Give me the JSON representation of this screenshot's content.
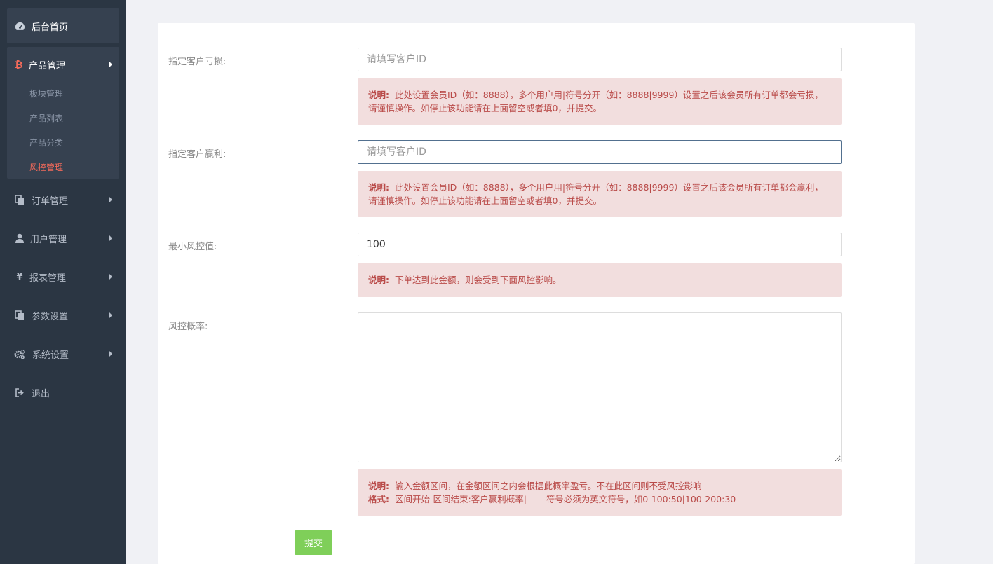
{
  "sidebar": {
    "home": {
      "label": "后台首页",
      "icon": "dashboard-icon"
    },
    "product": {
      "label": "产品管理",
      "icon": "bitcoin-icon",
      "icon_color": "#f36a5a",
      "items": [
        {
          "label": "板块管理"
        },
        {
          "label": "产品列表"
        },
        {
          "label": "产品分类"
        },
        {
          "label": "风控管理",
          "active": true
        }
      ]
    },
    "items": [
      {
        "label": "订单管理",
        "icon": "copy-icon"
      },
      {
        "label": "用户管理",
        "icon": "user-icon"
      },
      {
        "label": "报表管理",
        "icon": "yen-icon"
      },
      {
        "label": "参数设置",
        "icon": "copy-icon"
      },
      {
        "label": "系统设置",
        "icon": "gears-icon"
      },
      {
        "label": "退出",
        "icon": "sign-out-icon"
      }
    ]
  },
  "form": {
    "loss": {
      "label": "指定客户亏损:",
      "placeholder": "请填写客户ID",
      "note_prefix": "说明:",
      "note": "此处设置会员ID（如：8888），多个用户用|符号分开（如：8888|9999）设置之后该会员所有订单都会亏损，请谨慎操作。如停止该功能请在上面留空或者填0，并提交。"
    },
    "profit": {
      "label": "指定客户赢利:",
      "placeholder": "请填写客户ID",
      "note_prefix": "说明:",
      "note": "此处设置会员ID（如：8888），多个用户用|符号分开（如：8888|9999）设置之后该会员所有订单都会赢利，请谨慎操作。如停止该功能请在上面留空或者填0，并提交。"
    },
    "min_risk": {
      "label": "最小风控值:",
      "value": "100",
      "note_prefix": "说明:",
      "note": "下单达到此金额，则会受到下面风控影响。"
    },
    "probability": {
      "label": "风控概率:",
      "value": "",
      "note_prefix": "说明:",
      "note": "输入金额区间，在金额区间之内会根据此概率盈亏。不在此区间则不受风控影响",
      "format_prefix": "格式:",
      "format": "区间开始-区间结束:客户赢利概率|       符号必须为英文符号，如0-100:50|100-200:30"
    },
    "submit_label": "提交"
  },
  "colors": {
    "sidebar_bg": "#2b3643",
    "active_red": "#f36a5a",
    "alert_bg": "#f2dede",
    "alert_text": "#b94a48",
    "submit_green": "#7fcf59"
  }
}
